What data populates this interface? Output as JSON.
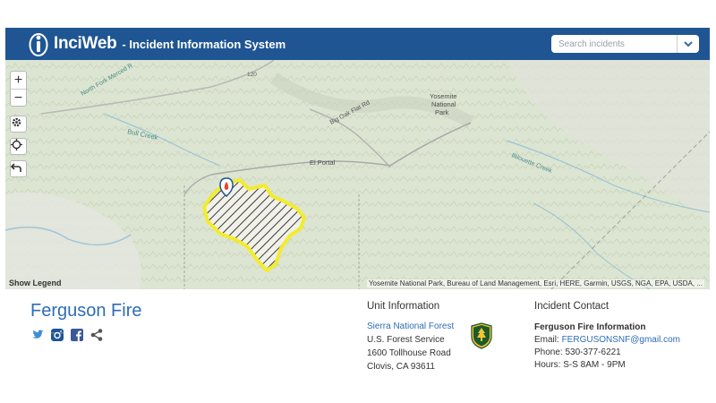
{
  "header": {
    "app_name": "InciWeb",
    "subtitle": "- Incident Information System",
    "search_placeholder": "Search incidents"
  },
  "map": {
    "labels": {
      "yosemite": "Yosemite",
      "national": "National",
      "park": "Park",
      "el_portal": "El Portal",
      "big_oak_flat_rd": "Big Oak Flat Rd",
      "bull_creek": "Bull Creek",
      "north_fork_merced": "North Fork Merced R",
      "illilouette_creek": "Illilouette Creek",
      "route_120": "120"
    },
    "legend_label": "Show Legend",
    "attribution": "Yosemite National Park, Bureau of Land Management, Esri, HERE, Garmin, USGS, NGA, EPA, USDA, ..."
  },
  "incident": {
    "title": "Ferguson Fire",
    "social_icons": [
      "twitter-icon",
      "instagram-icon",
      "facebook-icon",
      "share-icon"
    ]
  },
  "unit": {
    "heading": "Unit Information",
    "name": "Sierra National Forest",
    "agency": "U.S. Forest Service",
    "address1": "1600 Tollhouse Road",
    "address2": "Clovis, CA 93611"
  },
  "contact": {
    "heading": "Incident Contact",
    "name": "Ferguson Fire Information",
    "email_label": "Email:",
    "email": "FERGUSONSNF@gmail.com",
    "phone": "Phone: 530-377-6221",
    "hours": "Hours: S-S 8AM - 9PM"
  },
  "colors": {
    "header_bg": "#1f5593",
    "link": "#2e6db4",
    "fire_perimeter": "#f2ec2c"
  }
}
